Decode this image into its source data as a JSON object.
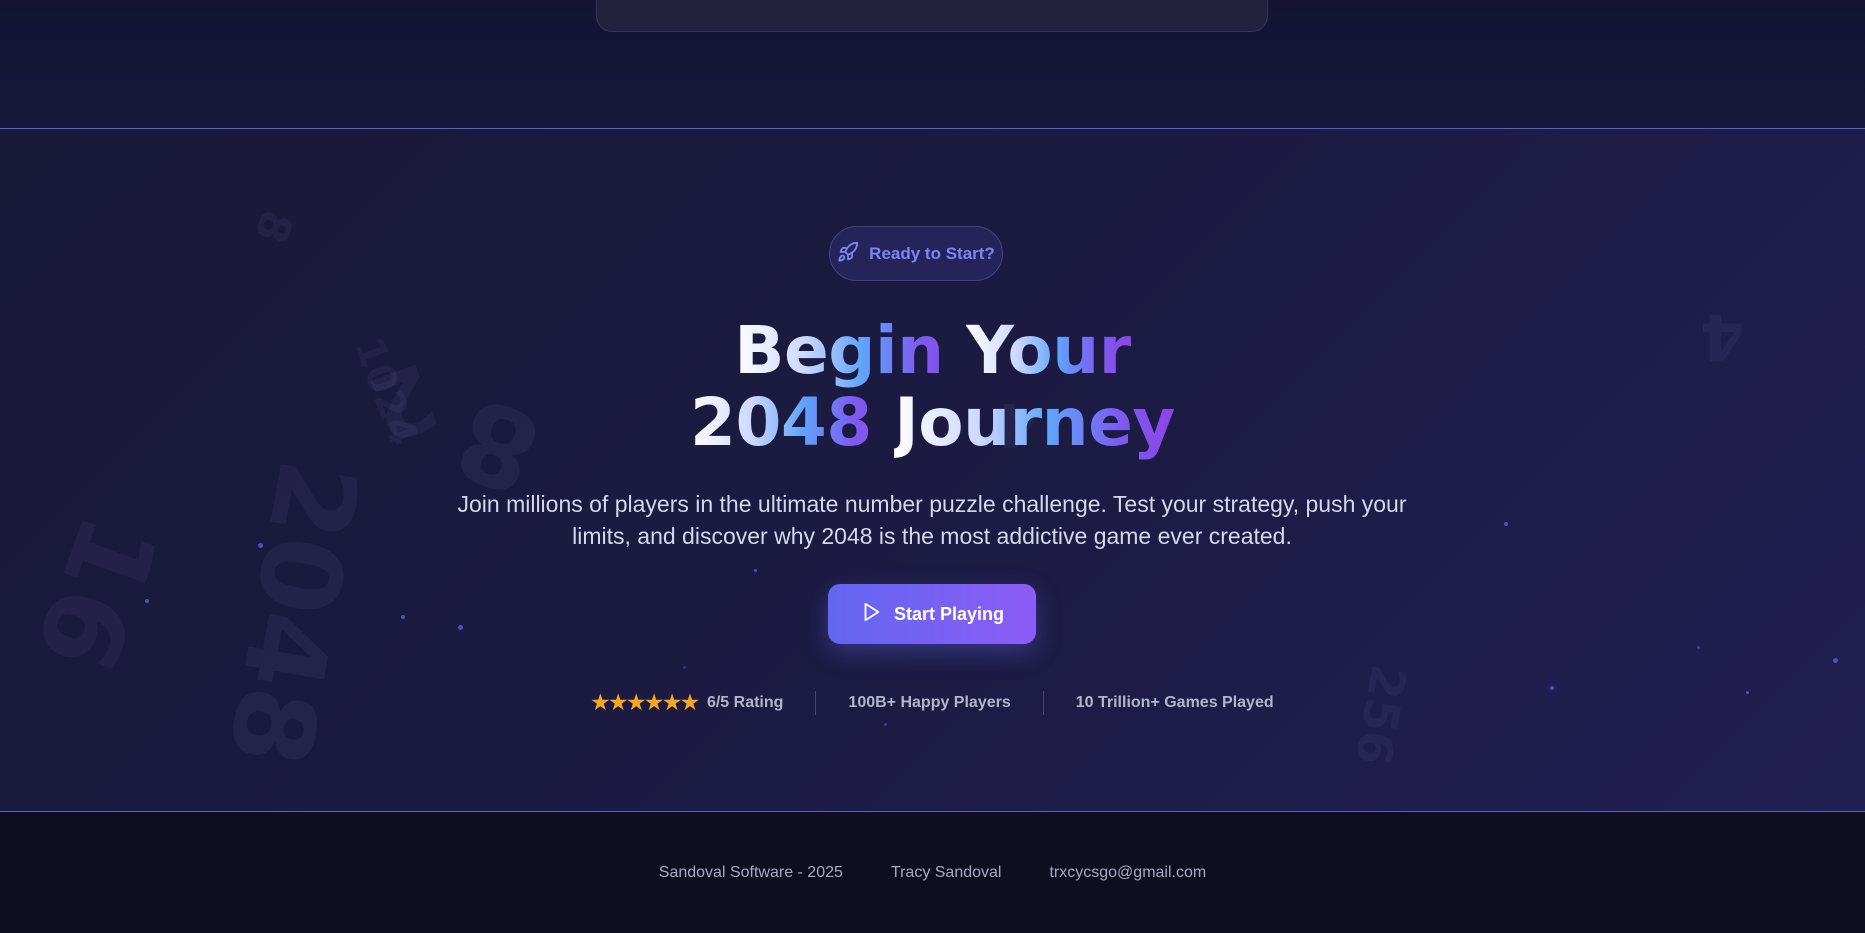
{
  "badge": {
    "label": "Ready to Start?",
    "icon": "rocket-icon"
  },
  "hero": {
    "title_line1_plain": "Begin ",
    "title_line1_grad": "Your",
    "title_line2_plain": "2048 ",
    "title_line2_grad": "Journey",
    "subtitle": "Join millions of players in the ultimate number puzzle challenge. Test your strategy, push your limits, and discover why 2048 is the most addictive game ever created."
  },
  "cta": {
    "label": "Start Playing",
    "icon": "play-icon"
  },
  "stats": {
    "rating_stars": "★★★★★★",
    "rating_label": "6/5 Rating",
    "players": "100B+ Happy Players",
    "games": "10 Trillion+ Games Played"
  },
  "background_numbers": [
    "8",
    "1024",
    "2",
    "16",
    "8",
    "2048",
    "4",
    "256",
    "4"
  ],
  "footer": {
    "company": "Sandoval Software - 2025",
    "author": "Tracy Sandoval",
    "email": "trxcycsgo@gmail.com"
  },
  "colors": {
    "accent": "#6366f1",
    "accent2": "#8b5cf6",
    "star": "#f5a623",
    "divider": "#5b5fc7"
  }
}
